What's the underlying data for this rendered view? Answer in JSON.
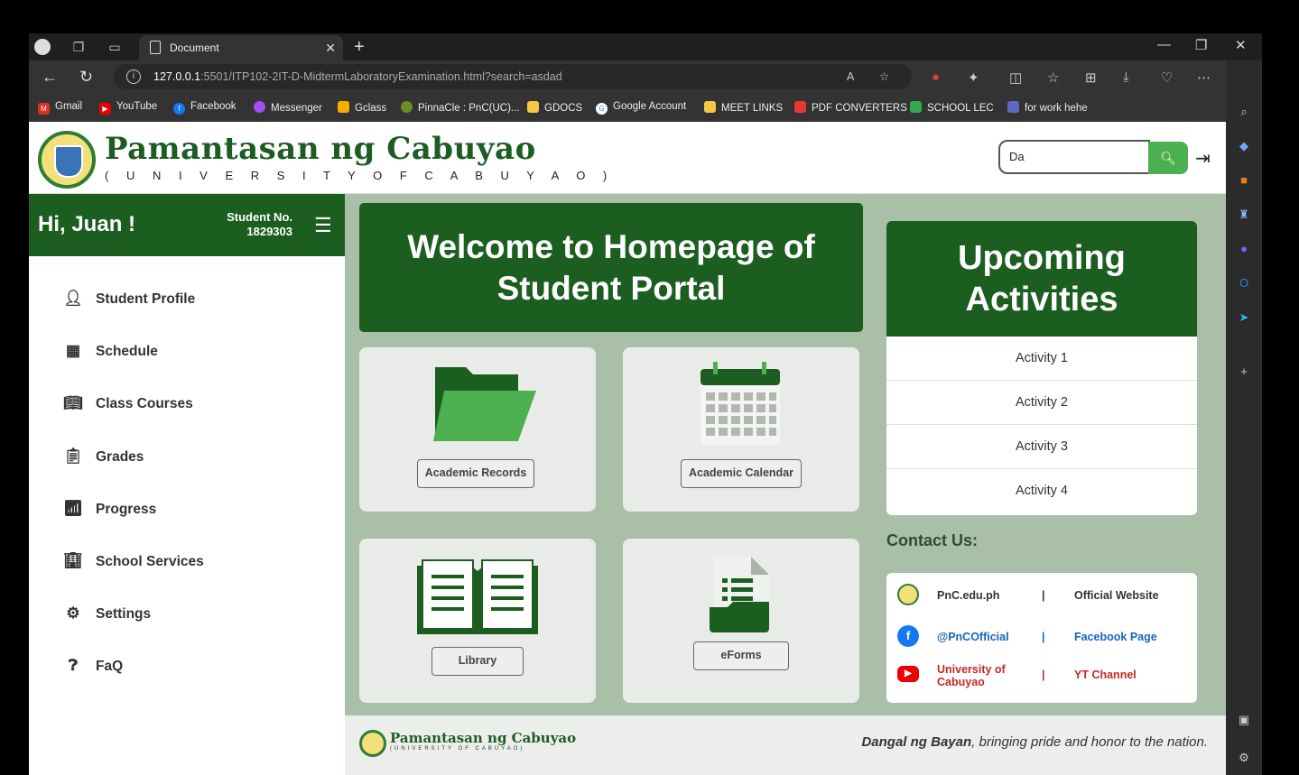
{
  "browser": {
    "tab_title": "Document",
    "url_host": "127.0.0.1",
    "url_rest": ":5501/ITP102-2IT-D-MidtermLaboratoryExamination.html?search=asdad"
  },
  "bookmarks": [
    "Gmail",
    "YouTube",
    "Facebook",
    "Messenger",
    "Gclass",
    "PinnaCle : PnC(UC)...",
    "GDOCS",
    "Google Account",
    "MEET LINKS",
    "PDF CONVERTERS",
    "SCHOOL LEC",
    "for work hehe"
  ],
  "header": {
    "brand": "Pamantasan ng Cabuyao",
    "brand_sub": "( U N I V E R S I T Y   O F   C A B U Y A O )",
    "search_value": "Da"
  },
  "sidebar": {
    "greeting": "Hi, Juan !",
    "student_no_label": "Student No.",
    "student_no": "1829303",
    "items": [
      "Student Profile",
      "Schedule",
      "Class Courses",
      "Grades",
      "Progress",
      "School Services",
      "Settings",
      "FaQ"
    ]
  },
  "main": {
    "welcome": "Welcome to Homepage of Student Portal",
    "cards": [
      "Academic Records",
      "Academic Calendar",
      "Library",
      "eForms"
    ]
  },
  "upcoming": {
    "title": "Upcoming Activities",
    "activities": [
      "Activity 1",
      "Activity 2",
      "Activity 3",
      "Activity 4"
    ]
  },
  "contact": {
    "title": "Contact Us:",
    "rows": [
      {
        "handle": "PnC.edu.ph",
        "sep": "|",
        "label": "Official Website"
      },
      {
        "handle": "@PnCOfficial",
        "sep": "|",
        "label": "Facebook Page"
      },
      {
        "handle": "University of Cabuyao",
        "sep": "|",
        "label": "YT Channel"
      }
    ]
  },
  "footer": {
    "brand": "Pamantasan ng Cabuyao",
    "brand_sub": "(UNIVERSITY OF CABUYAO)",
    "tag_bold": "Dangal ng Bayan",
    "tag_rest": ", bringing pride and honor to the nation."
  },
  "colors": {
    "primary_green": "#1b5e20",
    "main_bg": "#a9bfa8",
    "search_btn": "#4caf50"
  }
}
